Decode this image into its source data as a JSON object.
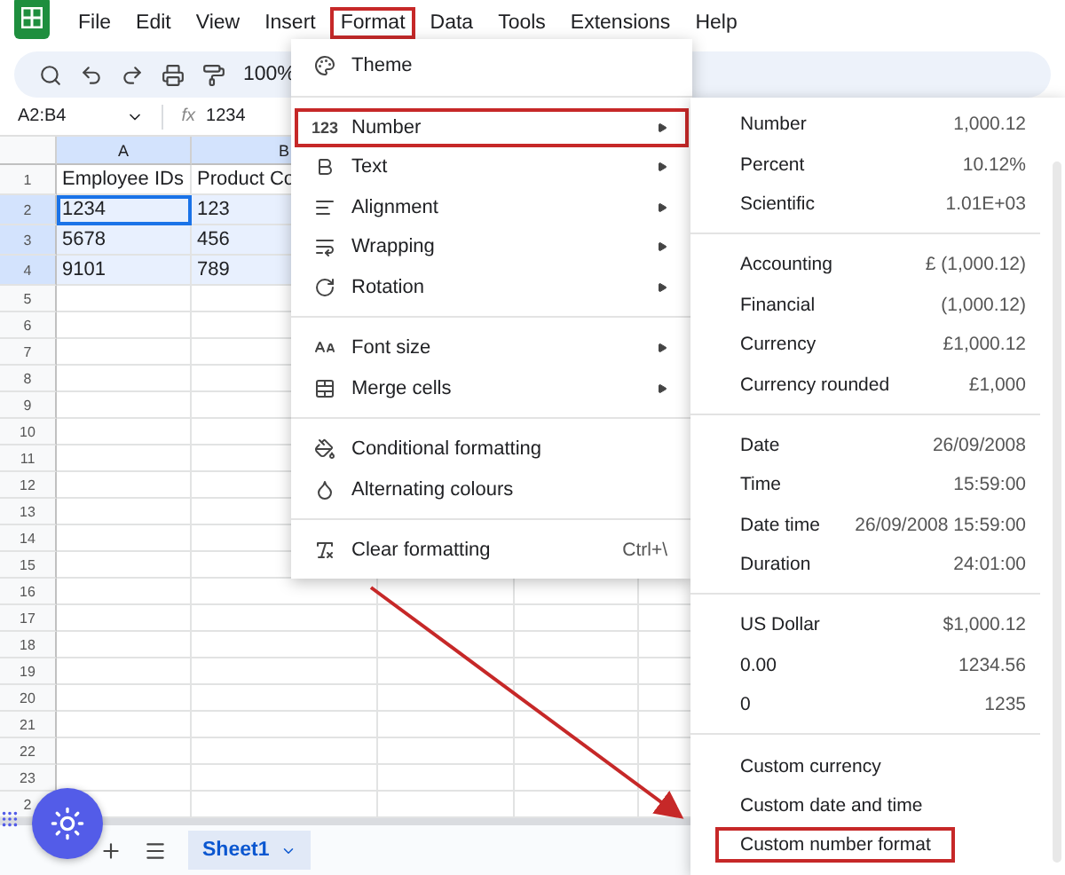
{
  "menubar": [
    {
      "label": "File",
      "highlighted": false
    },
    {
      "label": "Edit",
      "highlighted": false
    },
    {
      "label": "View",
      "highlighted": false
    },
    {
      "label": "Insert",
      "highlighted": false
    },
    {
      "label": "Format",
      "highlighted": true
    },
    {
      "label": "Data",
      "highlighted": false
    },
    {
      "label": "Tools",
      "highlighted": false
    },
    {
      "label": "Extensions",
      "highlighted": false
    },
    {
      "label": "Help",
      "highlighted": false
    }
  ],
  "toolbar": {
    "zoom": "100%"
  },
  "formula_bar": {
    "name_box": "A2:B4",
    "fx": "fx",
    "value": "1234"
  },
  "columns": [
    {
      "label": "A",
      "selected": true
    },
    {
      "label": "B",
      "selected": true
    }
  ],
  "rows": [
    {
      "label": "1",
      "selected": false,
      "cells": [
        {
          "text": "Employee IDs",
          "selected": false,
          "active": false
        },
        {
          "text": "Product Co",
          "selected": false,
          "active": false
        }
      ]
    },
    {
      "label": "2",
      "selected": true,
      "cells": [
        {
          "text": "1234",
          "selected": true,
          "active": true
        },
        {
          "text": "123",
          "selected": true,
          "active": false
        }
      ]
    },
    {
      "label": "3",
      "selected": true,
      "cells": [
        {
          "text": "5678",
          "selected": true,
          "active": false
        },
        {
          "text": "456",
          "selected": true,
          "active": false
        }
      ]
    },
    {
      "label": "4",
      "selected": true,
      "cells": [
        {
          "text": "9101",
          "selected": true,
          "active": false
        },
        {
          "text": "789",
          "selected": true,
          "active": false
        }
      ]
    },
    {
      "label": "5",
      "selected": false
    },
    {
      "label": "6",
      "selected": false
    },
    {
      "label": "7",
      "selected": false
    },
    {
      "label": "8",
      "selected": false
    },
    {
      "label": "9",
      "selected": false
    },
    {
      "label": "10",
      "selected": false
    },
    {
      "label": "11",
      "selected": false
    },
    {
      "label": "12",
      "selected": false
    },
    {
      "label": "13",
      "selected": false
    },
    {
      "label": "14",
      "selected": false
    },
    {
      "label": "15",
      "selected": false
    },
    {
      "label": "16",
      "selected": false
    },
    {
      "label": "17",
      "selected": false
    },
    {
      "label": "18",
      "selected": false
    },
    {
      "label": "19",
      "selected": false
    },
    {
      "label": "20",
      "selected": false
    },
    {
      "label": "21",
      "selected": false
    },
    {
      "label": "22",
      "selected": false
    },
    {
      "label": "23",
      "selected": false
    },
    {
      "label": "2",
      "selected": false
    }
  ],
  "format_menu": [
    [
      {
        "label": "Theme",
        "submenu": false,
        "highlighted": false
      }
    ],
    [
      {
        "label": "Number",
        "icon_text": "123",
        "submenu": true,
        "highlighted": true
      },
      {
        "label": "Text",
        "submenu": true,
        "highlighted": false
      },
      {
        "label": "Alignment",
        "submenu": true,
        "highlighted": false
      },
      {
        "label": "Wrapping",
        "submenu": true,
        "highlighted": false
      },
      {
        "label": "Rotation",
        "submenu": true,
        "highlighted": false
      }
    ],
    [
      {
        "label": "Font size",
        "submenu": true,
        "highlighted": false
      },
      {
        "label": "Merge cells",
        "submenu": true,
        "highlighted": false
      }
    ],
    [
      {
        "label": "Conditional formatting",
        "submenu": false,
        "highlighted": false
      },
      {
        "label": "Alternating colours",
        "submenu": false,
        "highlighted": false
      }
    ],
    [
      {
        "label": "Clear formatting",
        "submenu": false,
        "highlighted": false,
        "shortcut": "Ctrl+\\"
      }
    ]
  ],
  "number_menu": [
    [
      {
        "label": "Number",
        "example": "1,000.12",
        "highlighted": false
      },
      {
        "label": "Percent",
        "example": "10.12%",
        "highlighted": false
      },
      {
        "label": "Scientific",
        "example": "1.01E+03",
        "highlighted": false
      }
    ],
    [
      {
        "label": "Accounting",
        "example": "£ (1,000.12)",
        "highlighted": false
      },
      {
        "label": "Financial",
        "example": "(1,000.12)",
        "highlighted": false
      },
      {
        "label": "Currency",
        "example": "£1,000.12",
        "highlighted": false
      },
      {
        "label": "Currency rounded",
        "example": "£1,000",
        "highlighted": false
      }
    ],
    [
      {
        "label": "Date",
        "example": "26/09/2008",
        "highlighted": false
      },
      {
        "label": "Time",
        "example": "15:59:00",
        "highlighted": false
      },
      {
        "label": "Date time",
        "example": "26/09/2008 15:59:00",
        "highlighted": false
      },
      {
        "label": "Duration",
        "example": "24:01:00",
        "highlighted": false
      }
    ],
    [
      {
        "label": "US Dollar",
        "example": "$1,000.12",
        "highlighted": false
      },
      {
        "label": "0.00",
        "example": "1234.56",
        "highlighted": false
      },
      {
        "label": "0",
        "example": "1235",
        "highlighted": false
      }
    ],
    [
      {
        "label": "Custom currency",
        "highlighted": false
      },
      {
        "label": "Custom date and time",
        "highlighted": false
      },
      {
        "label": "Custom number format",
        "highlighted": true
      }
    ]
  ],
  "sheet_tabs": [
    {
      "label": "Sheet1",
      "selected": true
    }
  ]
}
